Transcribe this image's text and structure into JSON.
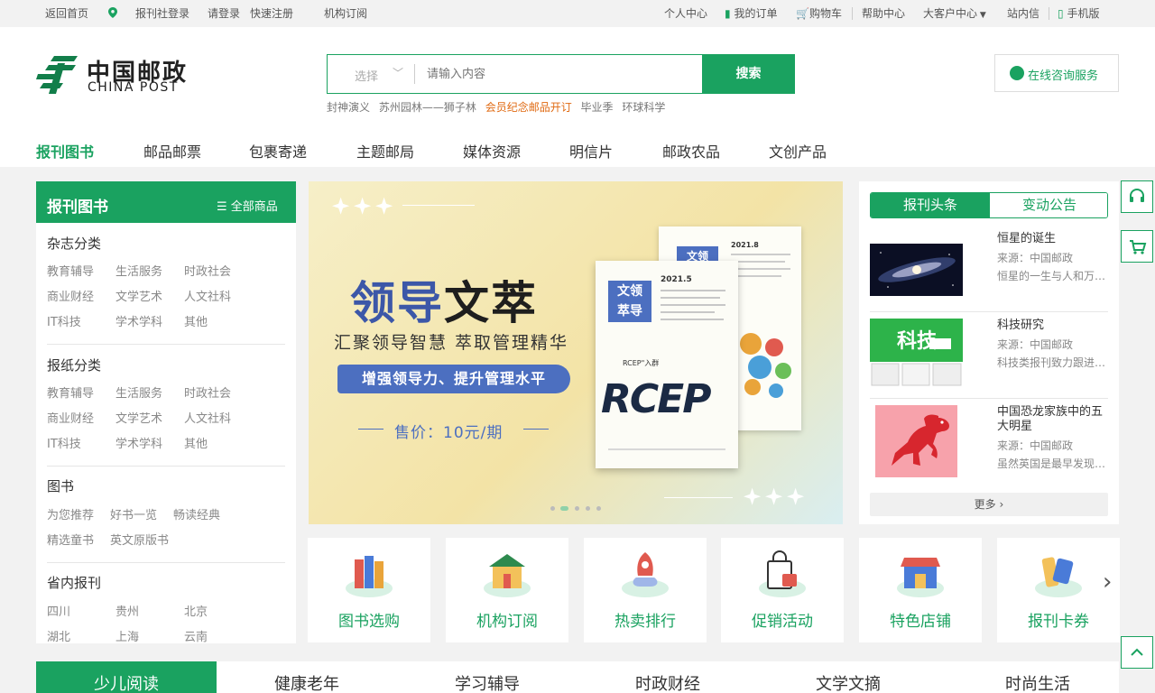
{
  "topbar": {
    "left": [
      "返回首页",
      "报刊社登录",
      "请登录",
      "快速注册",
      "机构订阅"
    ],
    "right": {
      "personal": "个人中心",
      "orders": "我的订单",
      "cart": "购物车",
      "help": "帮助中心",
      "bigclient": "大客户中心",
      "messages": "站内信",
      "mobile": "手机版"
    }
  },
  "logo": {
    "cn": "中国邮政",
    "en": "CHINA POST"
  },
  "search": {
    "select_label": "选择",
    "placeholder": "请输入内容",
    "button": "搜索",
    "hotwords": [
      "封神演义",
      "苏州园林——狮子林",
      "会员纪念邮品开订",
      "毕业季",
      "环球科学"
    ]
  },
  "consult": "在线咨询服务",
  "nav": [
    "报刊图书",
    "邮品邮票",
    "包裹寄递",
    "主题邮局",
    "媒体资源",
    "明信片",
    "邮政农品",
    "文创产品"
  ],
  "categories": {
    "title": "报刊图书",
    "all": "全部商品",
    "sections": [
      {
        "title": "杂志分类",
        "links": [
          "教育辅导",
          "生活服务",
          "时政社会",
          "商业财经",
          "文学艺术",
          "人文社科",
          "IT科技",
          "学术学科",
          "其他"
        ]
      },
      {
        "title": "报纸分类",
        "links": [
          "教育辅导",
          "生活服务",
          "时政社会",
          "商业财经",
          "文学艺术",
          "人文社科",
          "IT科技",
          "学术学科",
          "其他"
        ]
      },
      {
        "title": "图书",
        "links": [
          "为您推荐",
          "好书一览",
          "畅读经典",
          "精选童书",
          "英文原版书"
        ]
      },
      {
        "title": "省内报刊",
        "links": [
          "四川",
          "贵州",
          "北京",
          "湖北",
          "上海",
          "云南"
        ]
      }
    ]
  },
  "banner": {
    "title_a": "领导",
    "title_b": "文萃",
    "subtitle": "汇聚领导智慧  萃取管理精华",
    "pill": "增强领导力、提升管理水平",
    "price": "售价：10元/期",
    "mag_logo_1": "文领",
    "mag_logo_2": "萃导",
    "mag_issue_front": "2021.5",
    "mag_issue_back": "2021.8",
    "mag_headline": "RCEP\"入群",
    "mag_rcep": "RCEP"
  },
  "news": {
    "tabs": [
      "报刊头条",
      "变动公告"
    ],
    "items": [
      {
        "title": "恒星的诞生",
        "source": "来源：中国邮政",
        "summary": "恒星的一生与人和万…"
      },
      {
        "title": "科技研究",
        "source": "来源：中国邮政",
        "summary": "科技类报刊致力跟进…"
      },
      {
        "title": "中国恐龙家族中的五大明星",
        "source": "来源：中国邮政",
        "summary": "虽然英国是最早发现…"
      }
    ],
    "more": "更多"
  },
  "quick": [
    "图书选购",
    "机构订阅",
    "热卖排行",
    "促销活动",
    "特色店铺",
    "报刊卡券"
  ],
  "bottom_tabs": [
    "少儿阅读",
    "健康老年",
    "学习辅导",
    "时政财经",
    "文学文摘",
    "时尚生活"
  ],
  "colors": {
    "brand": "#1aa260",
    "accent": "#e06a12",
    "banner_blue": "#4c6fc0"
  }
}
